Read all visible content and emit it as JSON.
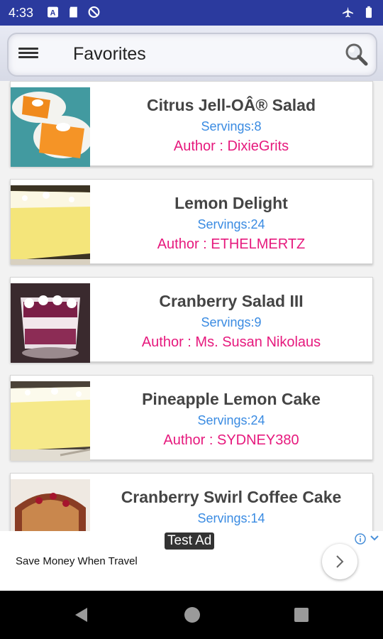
{
  "status_bar": {
    "time": "4:33",
    "icons": [
      "a-badge-icon",
      "sd-card-icon",
      "do-not-disturb-icon",
      "airplane-mode-icon",
      "battery-icon"
    ]
  },
  "app_bar": {
    "title": "Favorites",
    "menu_icon": "hamburger-menu-icon",
    "search_icon": "search-icon"
  },
  "recipes": [
    {
      "name": "Citrus Jell-OÂ® Salad",
      "servings": "Servings:8",
      "author": "Author : DixieGrits",
      "image": "orange-gelatin-squares"
    },
    {
      "name": "Lemon Delight",
      "servings": "Servings:24",
      "author": "Author : ETHELMERTZ",
      "image": "lemon-cake-slice"
    },
    {
      "name": "Cranberry Salad III",
      "servings": "Servings:9",
      "author": "Author : Ms. Susan Nikolaus",
      "image": "cranberry-parfait-glass"
    },
    {
      "name": "Pineapple Lemon Cake",
      "servings": "Servings:24",
      "author": "Author : SYDNEY380",
      "image": "pineapple-lemon-cake-slice"
    },
    {
      "name": "Cranberry Swirl Coffee Cake",
      "servings": "Servings:14",
      "author": "",
      "image": "cranberry-coffee-cake"
    }
  ],
  "ad": {
    "badge": "Test Ad",
    "text": "Save Money When Travel",
    "icons": [
      "ad-info-icon",
      "chevron-down-icon",
      "chevron-right-icon"
    ]
  },
  "nav_bar": {
    "icons": [
      "back-triangle-icon",
      "home-circle-icon",
      "recents-square-icon"
    ]
  },
  "colors": {
    "status_bar": "#2b3a9e",
    "servings_text": "#3a8be2",
    "author_text": "#e6197d",
    "title_text": "#444444"
  }
}
